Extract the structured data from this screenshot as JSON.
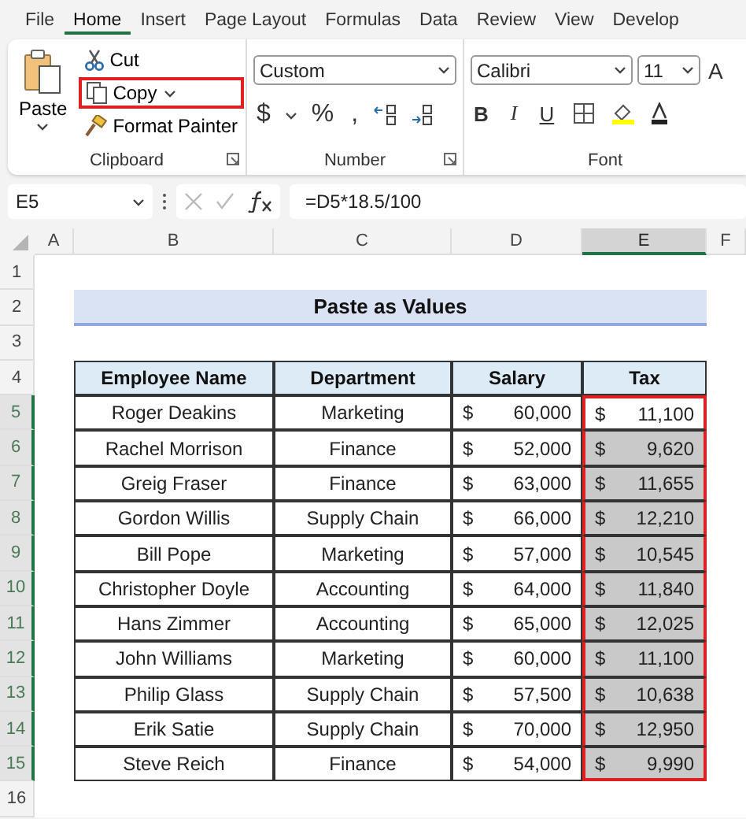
{
  "menu_tabs": [
    {
      "label": "File",
      "selected": false
    },
    {
      "label": "Home",
      "selected": true
    },
    {
      "label": "Insert",
      "selected": false
    },
    {
      "label": "Page Layout",
      "selected": false
    },
    {
      "label": "Formulas",
      "selected": false
    },
    {
      "label": "Data",
      "selected": false
    },
    {
      "label": "Review",
      "selected": false
    },
    {
      "label": "View",
      "selected": false
    },
    {
      "label": "Develop",
      "selected": false
    }
  ],
  "ribbon": {
    "clipboard": {
      "paste": "Paste",
      "cut": "Cut",
      "copy": {
        "label": "Copy",
        "highlighted": true
      },
      "format_painter": "Format Painter",
      "label": "Clipboard"
    },
    "number": {
      "format": "Custom",
      "symbols": [
        "$",
        "%",
        ","
      ],
      "label": "Number"
    },
    "font": {
      "name": "Calibri",
      "size": "11",
      "grow": "A",
      "styles": [
        "B",
        "I",
        "U"
      ],
      "label": "Font"
    }
  },
  "formula_bar": {
    "name_box": "E5",
    "formula": "=D5*18.5/100"
  },
  "sheet": {
    "columns": [
      {
        "label": "A",
        "selected": false
      },
      {
        "label": "B",
        "selected": false
      },
      {
        "label": "C",
        "selected": false
      },
      {
        "label": "D",
        "selected": false
      },
      {
        "label": "E",
        "selected": true
      },
      {
        "label": "F",
        "selected": false
      }
    ],
    "row_numbers": [
      {
        "label": "1",
        "selected": false
      },
      {
        "label": "2",
        "selected": false
      },
      {
        "label": "3",
        "selected": false
      },
      {
        "label": "4",
        "selected": false
      },
      {
        "label": "5",
        "selected": true
      },
      {
        "label": "6",
        "selected": true
      },
      {
        "label": "7",
        "selected": true
      },
      {
        "label": "8",
        "selected": true
      },
      {
        "label": "9",
        "selected": true
      },
      {
        "label": "10",
        "selected": true
      },
      {
        "label": "11",
        "selected": true
      },
      {
        "label": "12",
        "selected": true
      },
      {
        "label": "13",
        "selected": true
      },
      {
        "label": "14",
        "selected": true
      },
      {
        "label": "15",
        "selected": true
      },
      {
        "label": "16",
        "selected": false
      }
    ],
    "title": "Paste as Values",
    "table": {
      "headers": [
        "Employee Name",
        "Department",
        "Salary",
        "Tax"
      ],
      "tax_outlined": true,
      "rows": [
        {
          "name": "Roger Deakins",
          "department": "Marketing",
          "salary": {
            "symbol": "$",
            "amount": "60,000"
          },
          "tax": {
            "symbol": "$",
            "amount": "11,100",
            "selected": false
          }
        },
        {
          "name": "Rachel Morrison",
          "department": "Finance",
          "salary": {
            "symbol": "$",
            "amount": "52,000"
          },
          "tax": {
            "symbol": "$",
            "amount": "9,620",
            "selected": true
          }
        },
        {
          "name": "Greig Fraser",
          "department": "Finance",
          "salary": {
            "symbol": "$",
            "amount": "63,000"
          },
          "tax": {
            "symbol": "$",
            "amount": "11,655",
            "selected": true
          }
        },
        {
          "name": "Gordon Willis",
          "department": "Supply Chain",
          "salary": {
            "symbol": "$",
            "amount": "66,000"
          },
          "tax": {
            "symbol": "$",
            "amount": "12,210",
            "selected": true
          }
        },
        {
          "name": "Bill Pope",
          "department": "Marketing",
          "salary": {
            "symbol": "$",
            "amount": "57,000"
          },
          "tax": {
            "symbol": "$",
            "amount": "10,545",
            "selected": true
          }
        },
        {
          "name": "Christopher Doyle",
          "department": "Accounting",
          "salary": {
            "symbol": "$",
            "amount": "64,000"
          },
          "tax": {
            "symbol": "$",
            "amount": "11,840",
            "selected": true
          }
        },
        {
          "name": "Hans Zimmer",
          "department": "Accounting",
          "salary": {
            "symbol": "$",
            "amount": "65,000"
          },
          "tax": {
            "symbol": "$",
            "amount": "12,025",
            "selected": true
          }
        },
        {
          "name": "John Williams",
          "department": "Marketing",
          "salary": {
            "symbol": "$",
            "amount": "60,000"
          },
          "tax": {
            "symbol": "$",
            "amount": "11,100",
            "selected": true
          }
        },
        {
          "name": "Philip Glass",
          "department": "Supply Chain",
          "salary": {
            "symbol": "$",
            "amount": "57,500"
          },
          "tax": {
            "symbol": "$",
            "amount": "10,638",
            "selected": true
          }
        },
        {
          "name": "Erik Satie",
          "department": "Supply Chain",
          "salary": {
            "symbol": "$",
            "amount": "70,000"
          },
          "tax": {
            "symbol": "$",
            "amount": "12,950",
            "selected": true
          }
        },
        {
          "name": "Steve Reich",
          "department": "Finance",
          "salary": {
            "symbol": "$",
            "amount": "54,000"
          },
          "tax": {
            "symbol": "$",
            "amount": "9,990",
            "selected": true
          }
        }
      ]
    }
  }
}
